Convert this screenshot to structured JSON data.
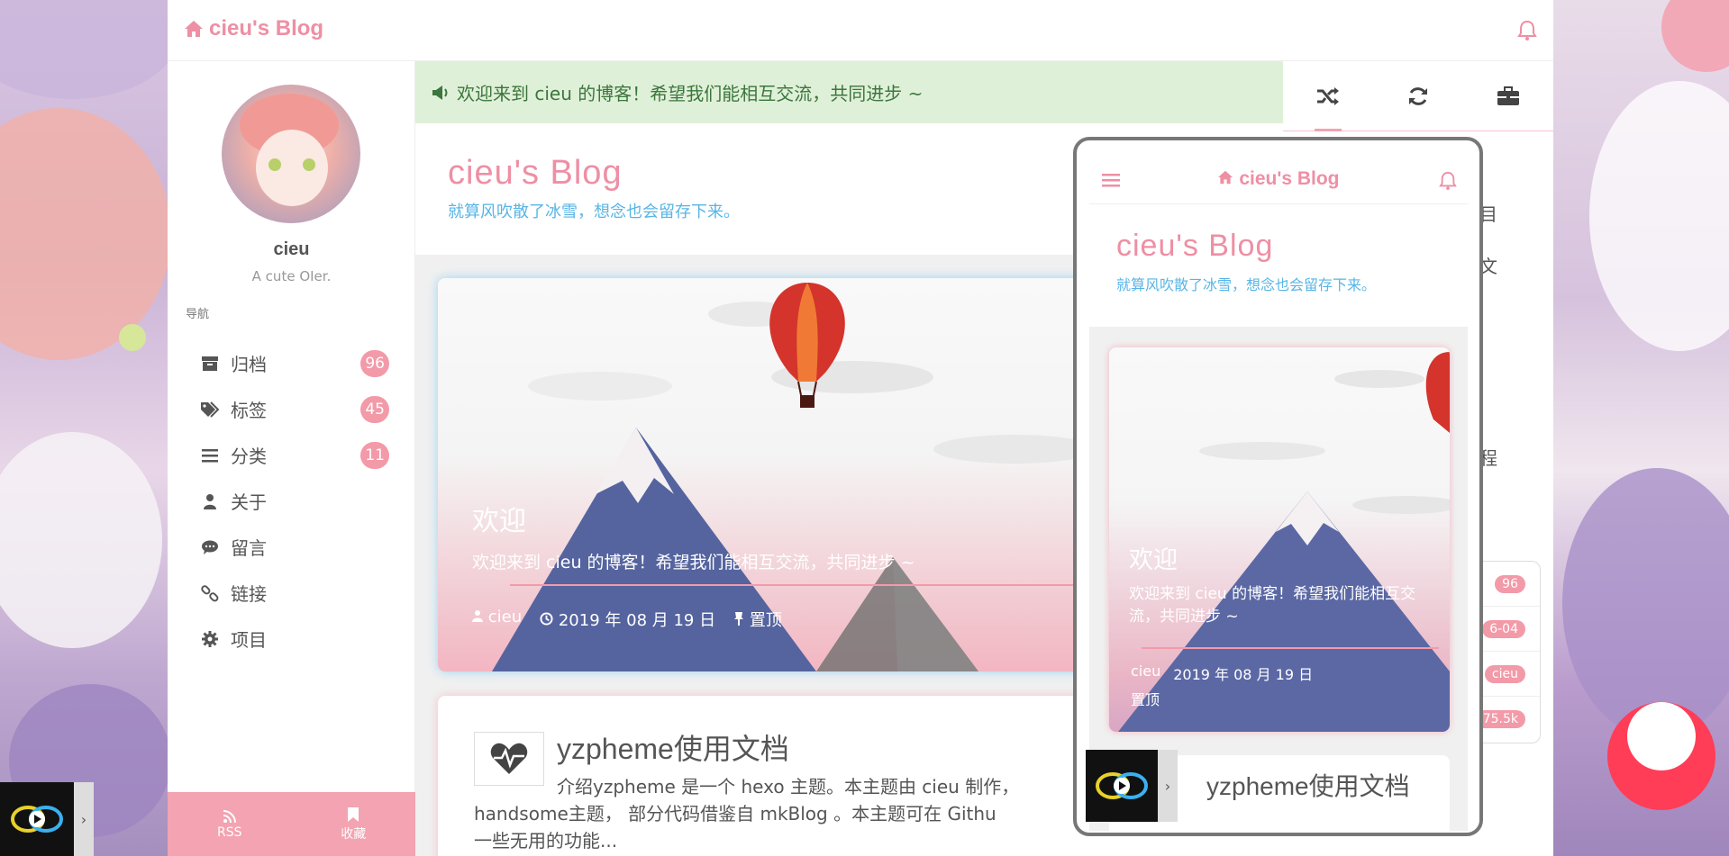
{
  "header": {
    "brand": "cieu's Blog"
  },
  "sidebar": {
    "author": "cieu",
    "motto": "A cute OIer.",
    "nav_label": "导航",
    "items": [
      {
        "label": "归档",
        "badge": "96",
        "icon": "archive-icon"
      },
      {
        "label": "标签",
        "badge": "45",
        "icon": "tags-icon"
      },
      {
        "label": "分类",
        "badge": "11",
        "icon": "list-icon"
      },
      {
        "label": "关于",
        "icon": "user-icon"
      },
      {
        "label": "留言",
        "icon": "comment-icon"
      },
      {
        "label": "链接",
        "icon": "link-icon"
      },
      {
        "label": "项目",
        "icon": "gear-icon"
      }
    ],
    "footer": {
      "rss": "RSS",
      "bookmark": "收藏"
    }
  },
  "notice": {
    "text": "欢迎来到 cieu 的博客！希望我们能相互交流，共同进步 ~"
  },
  "blog": {
    "title": "cieu's Blog",
    "subtitle": "就算风吹散了冰雪，想念也会留存下来。"
  },
  "hero_post": {
    "title": "欢迎",
    "excerpt": "欢迎来到 cieu 的博客！希望我们能相互交流，共同进步 ~",
    "author": "cieu",
    "date": "2019 年 08 月 19 日",
    "pinned": "置顶"
  },
  "post2": {
    "title": "yzpheme使用文档",
    "excerpt_1": "介绍yzpheme 是一个 hexo 主题。本主题由 cieu 制作，",
    "excerpt_2": "handsome主题， 部分代码借鉴自 mkBlog 。本主题可在 Githu",
    "excerpt_3": "一些无用的功能..."
  },
  "right_sidebar": {
    "fragments": [
      "目",
      "文",
      "程"
    ],
    "stats": [
      "96",
      "6-04",
      "cieu",
      "75.5k"
    ]
  },
  "mobile": {
    "brand": "cieu's Blog",
    "title": "cieu's Blog",
    "subtitle": "就算风吹散了冰雪，想念也会留存下来。",
    "post_title": "欢迎",
    "post_excerpt": "欢迎来到 cieu 的博客！希望我们能相互交流，共同进步 ~",
    "post_author": "cieu",
    "post_date": "2019 年 08 月 19 日",
    "post_pinned": "置顶",
    "post2_title": "yzpheme使用文档"
  },
  "colors": {
    "brand_pink": "#ee8fa4",
    "badge_pink": "#f39aa9",
    "subtitle_blue": "#58b5e6",
    "notice_bg": "#dff0d8",
    "notice_text": "#3c763d"
  }
}
